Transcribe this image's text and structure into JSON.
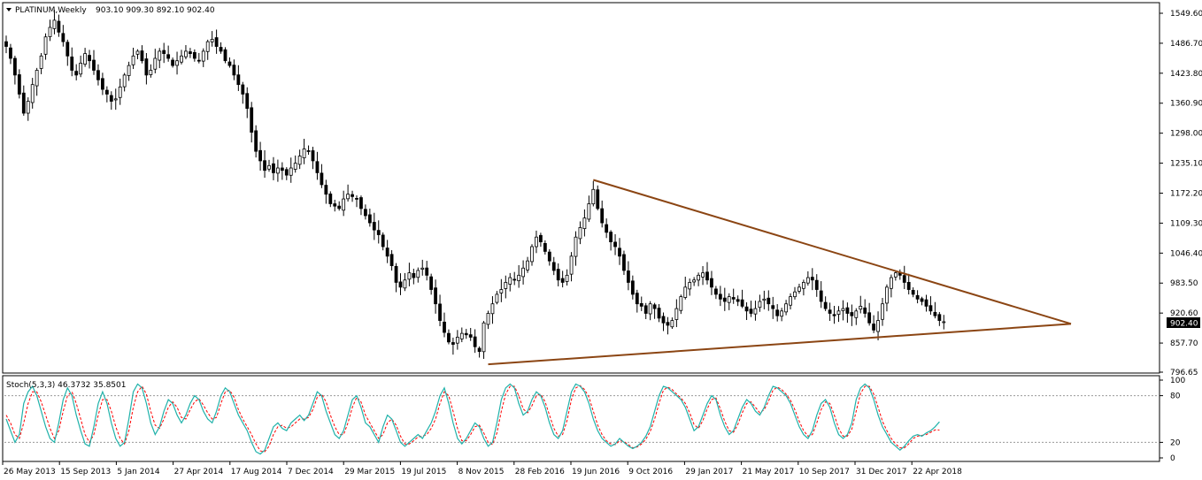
{
  "symbol_header": {
    "symbol": "PLATINUM,Weekly",
    "ohlc": "903.10 909.30 892.10 902.40"
  },
  "colors": {
    "background": "#ffffff",
    "candle": "#000000",
    "trendline": "#8B4513",
    "stoch_main": "#20B2AA",
    "stoch_signal": "#FF0000",
    "price_badge_bg": "#000000",
    "price_badge_text": "#ffffff"
  },
  "chart_data": [
    {
      "type": "candlestick",
      "title": "PLATINUM,Weekly",
      "ohlc_last": {
        "open": 903.1,
        "high": 909.3,
        "low": 892.1,
        "close": 902.4
      },
      "current_price_label": "902.40",
      "y_ticks": [
        "1549.60",
        "1486.70",
        "1423.80",
        "1360.90",
        "1298.00",
        "1235.10",
        "1172.20",
        "1109.30",
        "1046.40",
        "983.50",
        "920.60",
        "857.70",
        "796.65"
      ],
      "y_tick_values": [
        1549.6,
        1486.7,
        1423.8,
        1360.9,
        1298.0,
        1235.1,
        1172.2,
        1109.3,
        1046.4,
        983.5,
        920.6,
        857.7,
        796.65
      ],
      "ylim": [
        796.65,
        1570
      ],
      "x_ticks": [
        "26 May 2013",
        "15 Sep 2013",
        "5 Jan 2014",
        "27 Apr 2014",
        "17 Aug 2014",
        "7 Dec 2014",
        "29 Mar 2015",
        "19 Jul 2015",
        "8 Nov 2015",
        "28 Feb 2016",
        "19 Jun 2016",
        "9 Oct 2016",
        "29 Jan 2017",
        "21 May 2017",
        "10 Sep 2017",
        "31 Dec 2017",
        "22 Apr 2018"
      ],
      "series": [
        {
          "closes": [
            1480,
            1455,
            1420,
            1380,
            1340,
            1365,
            1400,
            1430,
            1460,
            1500,
            1520,
            1535,
            1510,
            1490,
            1460,
            1430,
            1420,
            1445,
            1465,
            1450,
            1430,
            1410,
            1390,
            1380,
            1365,
            1370,
            1395,
            1420,
            1440,
            1460,
            1470,
            1450,
            1420,
            1430,
            1455,
            1470,
            1465,
            1455,
            1440,
            1450,
            1460,
            1470,
            1465,
            1455,
            1450,
            1470,
            1490,
            1495,
            1480,
            1470,
            1450,
            1440,
            1420,
            1400,
            1380,
            1350,
            1300,
            1260,
            1240,
            1220,
            1230,
            1215,
            1225,
            1220,
            1210,
            1225,
            1235,
            1250,
            1265,
            1260,
            1240,
            1215,
            1190,
            1170,
            1150,
            1145,
            1140,
            1160,
            1170,
            1165,
            1160,
            1140,
            1125,
            1110,
            1095,
            1085,
            1060,
            1040,
            1020,
            985,
            975,
            990,
            1005,
            995,
            1010,
            1015,
            1000,
            970,
            940,
            905,
            880,
            860,
            855,
            870,
            878,
            875,
            870,
            850,
            840,
            900,
            920,
            940,
            960,
            970,
            985,
            995,
            990,
            1000,
            1015,
            1030,
            1060,
            1080,
            1070,
            1050,
            1030,
            1010,
            990,
            985,
            1000,
            1040,
            1080,
            1100,
            1120,
            1150,
            1180,
            1140,
            1110,
            1090,
            1070,
            1060,
            1040,
            1010,
            985,
            960,
            940,
            935,
            920,
            940,
            930,
            910,
            900,
            895,
            905,
            930,
            955,
            975,
            985,
            990,
            1000,
            1005,
            990,
            975,
            960,
            950,
            945,
            955,
            950,
            945,
            935,
            925,
            920,
            930,
            945,
            950,
            940,
            930,
            915,
            925,
            940,
            955,
            965,
            975,
            985,
            995,
            990,
            970,
            945,
            930,
            920,
            915,
            925,
            930,
            920,
            915,
            925,
            935,
            920,
            900,
            885,
            905,
            940,
            975,
            995,
            1005,
            1000,
            985,
            970,
            960,
            950,
            945,
            935,
            925,
            915,
            905,
            902.4
          ]
        }
      ],
      "trendlines": [
        {
          "name": "upper",
          "from": {
            "date": "19 Jun 2016",
            "price": 1200
          },
          "to": {
            "date": "projected",
            "price": 898
          }
        },
        {
          "name": "lower",
          "from": {
            "date": "8 Nov 2015",
            "price": 813
          },
          "to": {
            "date": "projected",
            "price": 898
          }
        }
      ]
    },
    {
      "type": "line",
      "title": "Stoch(5,3,3) 46.3732 35.8501",
      "ylim": [
        0,
        100
      ],
      "y_ticks": [
        "100",
        "80",
        "20",
        "0"
      ],
      "y_tick_values": [
        100,
        80,
        20,
        0
      ],
      "levels": [
        80,
        20
      ],
      "series": [
        {
          "name": "%K",
          "values": [
            50,
            35,
            20,
            30,
            70,
            85,
            92,
            80,
            60,
            40,
            25,
            20,
            45,
            75,
            90,
            80,
            55,
            35,
            18,
            15,
            40,
            70,
            85,
            70,
            45,
            25,
            15,
            20,
            50,
            85,
            95,
            90,
            70,
            45,
            30,
            40,
            60,
            75,
            70,
            55,
            45,
            55,
            70,
            80,
            75,
            60,
            50,
            45,
            60,
            80,
            90,
            85,
            70,
            55,
            45,
            35,
            20,
            8,
            5,
            10,
            25,
            40,
            45,
            38,
            35,
            45,
            50,
            55,
            48,
            55,
            70,
            85,
            80,
            60,
            45,
            30,
            25,
            35,
            55,
            75,
            80,
            65,
            45,
            40,
            30,
            20,
            40,
            55,
            50,
            35,
            20,
            15,
            20,
            25,
            30,
            25,
            35,
            45,
            60,
            80,
            90,
            70,
            45,
            25,
            18,
            25,
            35,
            45,
            40,
            25,
            15,
            20,
            45,
            75,
            90,
            95,
            90,
            70,
            55,
            60,
            75,
            85,
            80,
            65,
            45,
            30,
            25,
            35,
            60,
            85,
            95,
            92,
            85,
            70,
            50,
            35,
            25,
            20,
            15,
            18,
            25,
            20,
            15,
            12,
            15,
            20,
            28,
            40,
            60,
            80,
            92,
            90,
            85,
            80,
            75,
            65,
            50,
            35,
            40,
            55,
            70,
            80,
            75,
            55,
            40,
            30,
            35,
            50,
            65,
            75,
            70,
            60,
            55,
            65,
            80,
            92,
            90,
            85,
            80,
            70,
            55,
            40,
            30,
            25,
            35,
            55,
            70,
            75,
            65,
            45,
            30,
            25,
            30,
            45,
            75,
            90,
            95,
            90,
            75,
            55,
            40,
            30,
            20,
            15,
            10,
            15,
            22,
            28,
            30,
            28,
            32,
            35,
            40,
            46.37
          ]
        },
        {
          "name": "%D",
          "values": [
            55,
            45,
            30,
            25,
            45,
            70,
            85,
            85,
            72,
            55,
            38,
            25,
            35,
            60,
            80,
            85,
            70,
            50,
            30,
            20,
            30,
            55,
            75,
            75,
            60,
            40,
            25,
            18,
            35,
            65,
            85,
            92,
            82,
            60,
            42,
            38,
            50,
            65,
            72,
            65,
            52,
            50,
            62,
            72,
            76,
            68,
            58,
            50,
            52,
            70,
            85,
            87,
            78,
            62,
            50,
            40,
            30,
            18,
            9,
            8,
            15,
            30,
            40,
            42,
            38,
            40,
            45,
            50,
            50,
            52,
            62,
            78,
            82,
            72,
            55,
            40,
            30,
            30,
            45,
            65,
            78,
            72,
            55,
            45,
            35,
            25,
            30,
            45,
            50,
            42,
            28,
            18,
            18,
            22,
            27,
            28,
            30,
            38,
            50,
            70,
            85,
            80,
            60,
            38,
            22,
            22,
            30,
            40,
            42,
            32,
            20,
            17,
            32,
            60,
            82,
            92,
            92,
            80,
            63,
            58,
            67,
            80,
            82,
            72,
            55,
            38,
            28,
            30,
            48,
            75,
            90,
            93,
            88,
            78,
            60,
            42,
            30,
            22,
            18,
            17,
            22,
            21,
            17,
            13,
            14,
            18,
            24,
            34,
            50,
            70,
            87,
            91,
            88,
            82,
            77,
            70,
            58,
            43,
            38,
            48,
            63,
            75,
            77,
            63,
            47,
            35,
            33,
            43,
            58,
            70,
            72,
            65,
            58,
            62,
            73,
            87,
            91,
            88,
            82,
            74,
            62,
            47,
            35,
            28,
            30,
            45,
            62,
            72,
            70,
            55,
            38,
            28,
            28,
            37,
            60,
            83,
            92,
            92,
            82,
            65,
            47,
            35,
            25,
            18,
            13,
            13,
            18,
            25,
            28,
            29,
            30,
            33,
            36,
            35.85
          ]
        }
      ]
    }
  ]
}
